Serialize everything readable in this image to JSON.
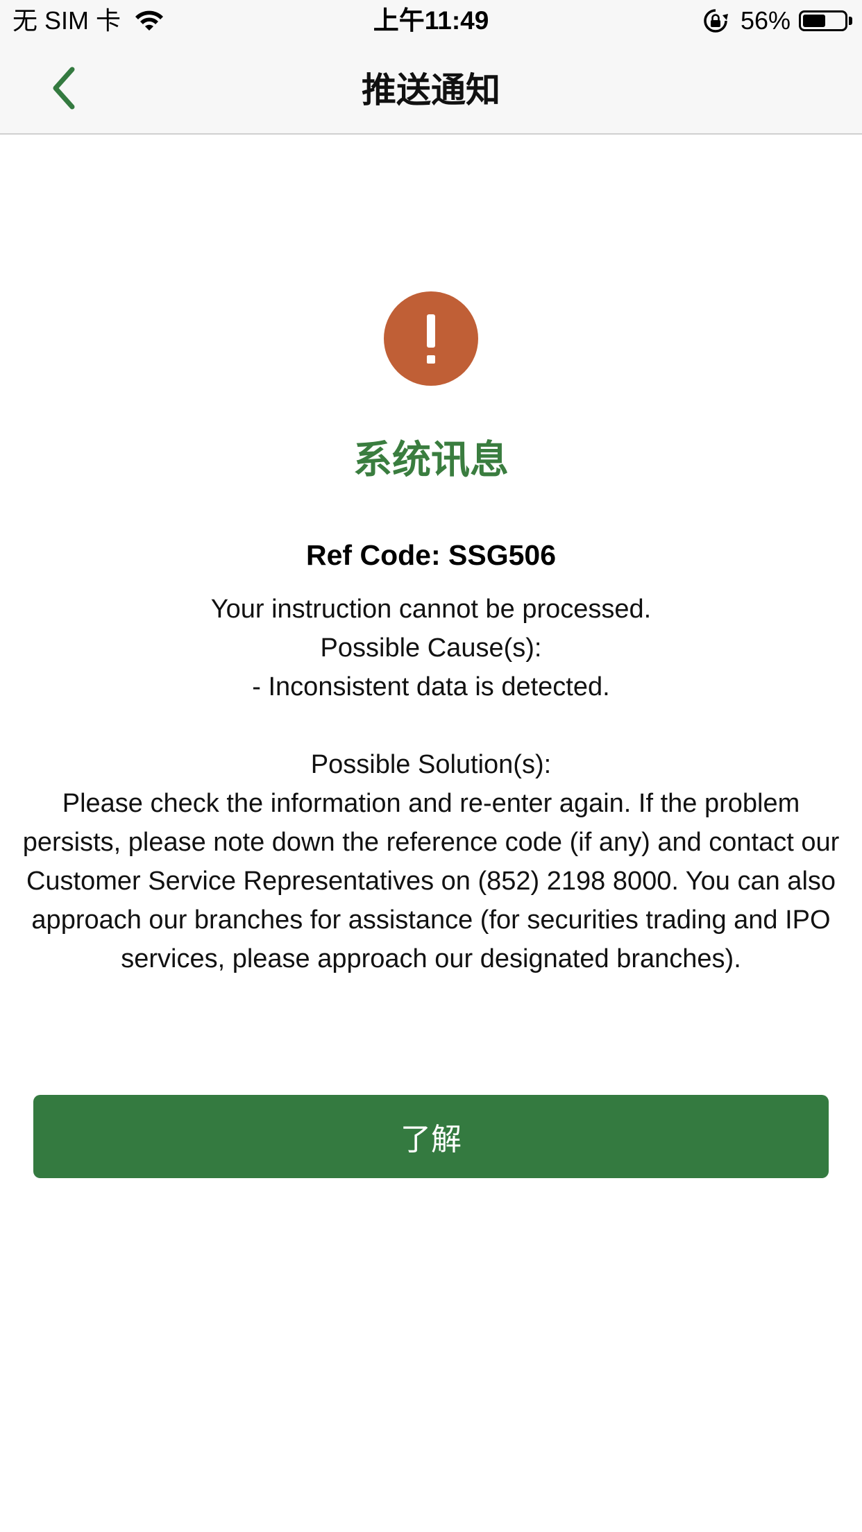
{
  "status_bar": {
    "carrier": "无 SIM 卡",
    "time": "上午11:49",
    "battery_percent": "56%",
    "battery_level": 0.56
  },
  "nav": {
    "title": "推送通知",
    "back_icon": "chevron-left-icon"
  },
  "message": {
    "icon": "exclamation-icon",
    "title": "系统讯息",
    "ref_code": "Ref Code: SSG506",
    "body": "Your instruction cannot be processed.\nPossible Cause(s):\n- Inconsistent data is detected.\n\nPossible Solution(s):\nPlease check the information and re-enter again. If the problem persists, please note down the reference code (if any) and contact our Customer Service Representatives on (852) 2198 8000. You can also approach our branches for assistance (for securities trading and IPO services, please approach our designated branches)."
  },
  "actions": {
    "ack_label": "了解"
  },
  "colors": {
    "brand_green": "#347a40",
    "title_green": "#3a7d3f",
    "alert_orange": "#c05f36"
  }
}
